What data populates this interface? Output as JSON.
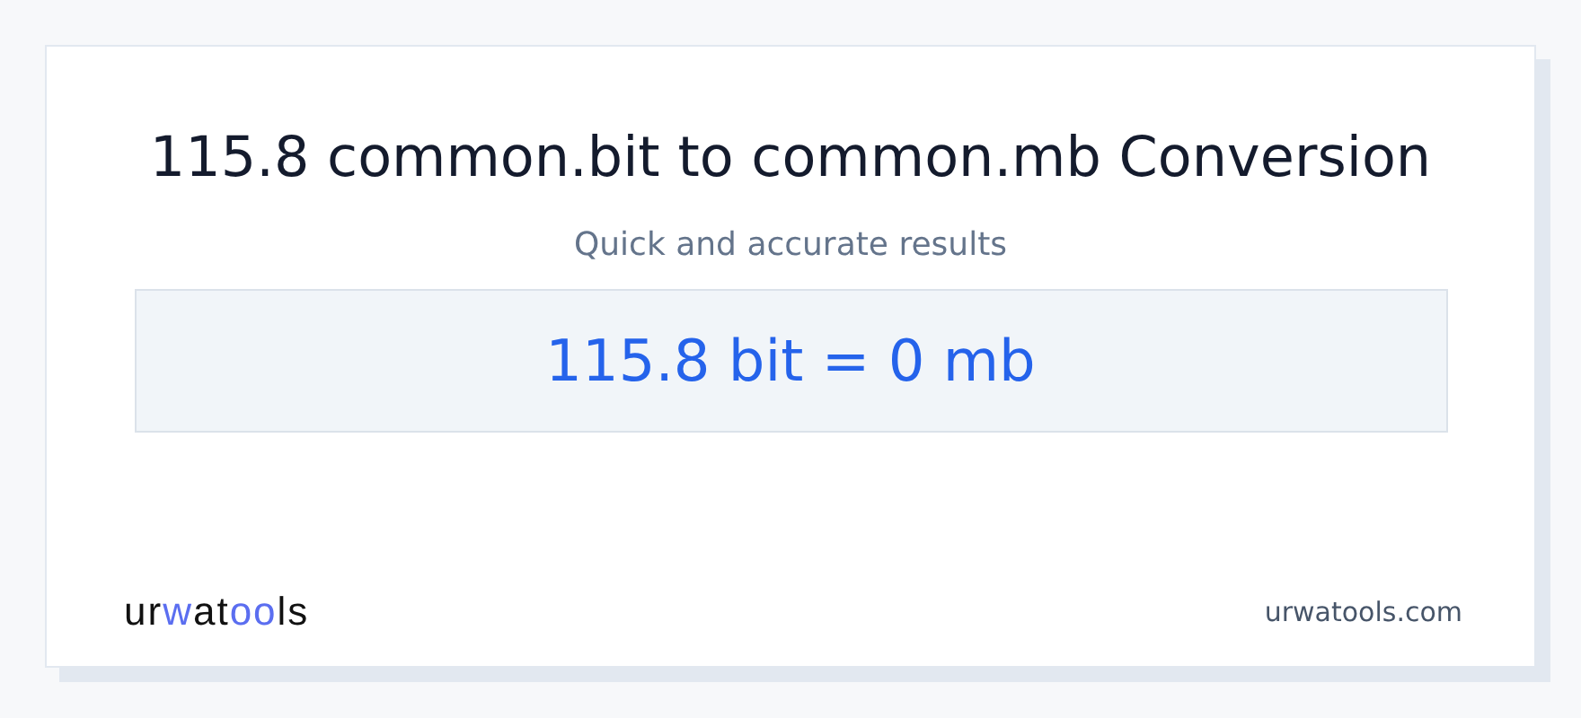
{
  "title": "115.8 common.bit to common.mb Conversion",
  "subtitle": "Quick and accurate results",
  "result": "115.8 bit = 0 mb",
  "logo": [
    {
      "text": "ur",
      "accent": false
    },
    {
      "text": "w",
      "accent": true
    },
    {
      "text": "at",
      "accent": false
    },
    {
      "text": "oo",
      "accent": true
    },
    {
      "text": "ls",
      "accent": false
    }
  ],
  "site": "urwatools.com"
}
